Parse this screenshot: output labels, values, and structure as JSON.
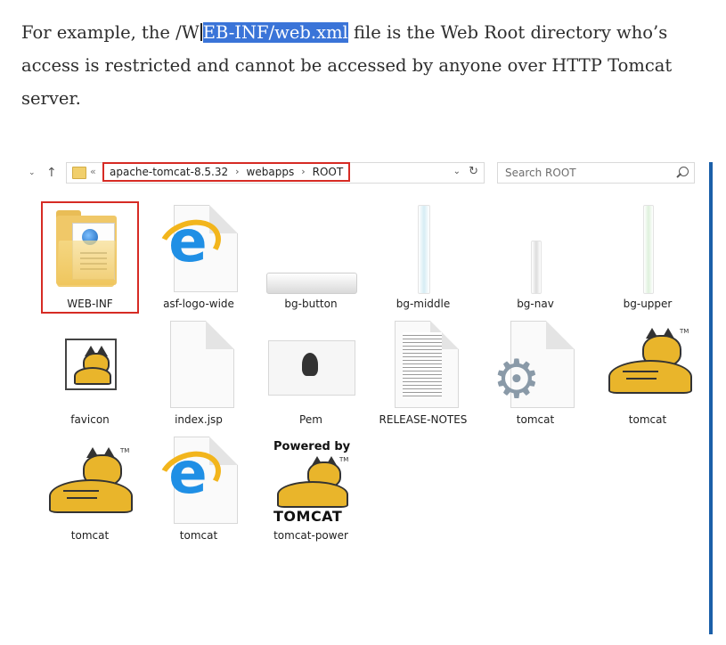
{
  "article": {
    "before": "For example, the /W",
    "highlight": "EB-INF/web.xml",
    "after": " file is the Web Root directory who’s access is restricted and cannot be accessed by anyone over HTTP Tomcat server."
  },
  "explorer": {
    "nav": {
      "recent_glyph": "⌄",
      "up_glyph": "↑"
    },
    "address": {
      "overflow": "«",
      "crumbs": [
        "apache-tomcat-8.5.32",
        "webapps",
        "ROOT"
      ],
      "separator": "›",
      "dropdown_glyph": "⌄",
      "refresh_glyph": "↻"
    },
    "search": {
      "placeholder": "Search ROOT",
      "value": ""
    },
    "items": [
      {
        "label": "WEB-INF",
        "icon": "folder-icon",
        "selected": true
      },
      {
        "label": "asf-logo-wide",
        "icon": "ie-html-icon"
      },
      {
        "label": "bg-button",
        "icon": "image-thumb-icon"
      },
      {
        "label": "bg-middle",
        "icon": "image-thumb-icon"
      },
      {
        "label": "bg-nav",
        "icon": "image-thumb-icon"
      },
      {
        "label": "bg-upper",
        "icon": "image-thumb-icon"
      },
      {
        "label": "favicon",
        "icon": "tomcat-favicon-icon"
      },
      {
        "label": "index.jsp",
        "icon": "blank-file-icon"
      },
      {
        "label": "Pem",
        "icon": "pem-file-icon"
      },
      {
        "label": "RELEASE-NOTES",
        "icon": "text-file-icon"
      },
      {
        "label": "tomcat",
        "icon": "gear-file-icon"
      },
      {
        "label": "tomcat",
        "icon": "tomcat-logo-icon"
      },
      {
        "label": "tomcat",
        "icon": "tomcat-logo-icon"
      },
      {
        "label": "tomcat",
        "icon": "ie-html-icon"
      },
      {
        "label": "tomcat-power",
        "icon": "tomcat-power-icon"
      }
    ],
    "power_badge": {
      "top": "Powered by",
      "bottom": "TOMCAT",
      "tm": "TM"
    },
    "tm_mark": "TM",
    "colors": {
      "highlight_box": "#d62b24",
      "selection_text": "#3a74d8",
      "scrollbar": "#1b5fa9"
    }
  }
}
